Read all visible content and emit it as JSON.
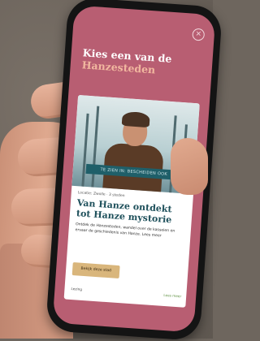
{
  "screen": {
    "headline_line1": "Kies een van de",
    "headline_line2": "Hanzesteden",
    "close_symbol": "×"
  },
  "card": {
    "banner": "TE ZIEN IN: BESCHEIDEN OOK",
    "meta": "Locatie: Zwolle  ·  3 steden",
    "title": "Van Hanze ontdekt tot Hanze mystorie",
    "text": "Ontdek de Hanzesteden, wandel over de kasseien en ervaar de geschiedenis van Hanze. Lees meer",
    "cta": "Bekijk deze stad",
    "footer_left": "Lezing",
    "footer_right": "Lees meer"
  },
  "colors": {
    "screen_bg": "#b85e72",
    "headline_accent": "#f1b79f",
    "card_title": "#1d4f5a",
    "cta_bg": "#d9b67c"
  }
}
